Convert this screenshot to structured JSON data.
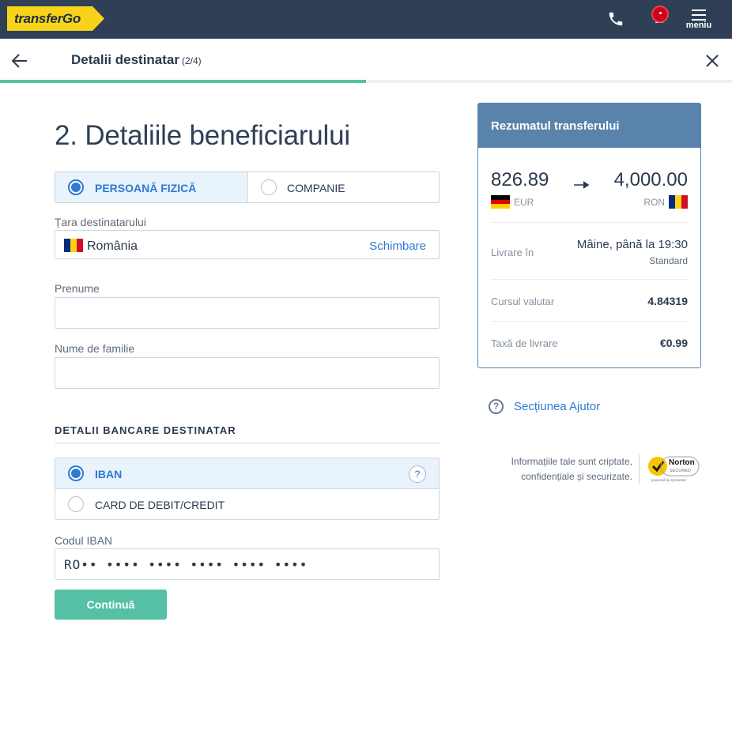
{
  "header": {
    "logo_text": "transferGo",
    "menu_label": "meniu",
    "brand_yellow": "#f7d31a",
    "bar_color": "#2f4056"
  },
  "step": {
    "title": "Detalii destinatar",
    "count": "(2/4)",
    "progress": 0.5
  },
  "form": {
    "page_title": "2. Detaliile beneficiarului",
    "type_options": [
      {
        "label": "PERSOANĂ FIZICĂ",
        "selected": true
      },
      {
        "label": "COMPANIE",
        "selected": false
      }
    ],
    "country_label": "Țara destinatarului",
    "country_value": "România",
    "country_change": "Schimbare",
    "first_name_label": "Prenume",
    "first_name_value": "",
    "last_name_label": "Nume de familie",
    "last_name_value": "",
    "bank_section_title": "DETALII BANCARE DESTINATAR",
    "bank_options": [
      {
        "label": "IBAN",
        "selected": true,
        "help": "?"
      },
      {
        "label": "CARD DE DEBIT/CREDIT",
        "selected": false
      }
    ],
    "iban_label": "Codul IBAN",
    "iban_placeholder": "RO•• •••• •••• •••• •••• ••••",
    "continue_label": "Continuă",
    "accent_color": "#55c0a3",
    "link_color": "#2e7ad1"
  },
  "summary": {
    "title": "Rezumatul transferului",
    "send_amount": "826.89",
    "send_currency": "EUR",
    "receive_amount": "4,000.00",
    "receive_currency": "RON",
    "delivery_label": "Livrare în",
    "delivery_value": "Mâine, până la 19:30",
    "delivery_type": "Standard",
    "rate_label": "Cursul valutar",
    "rate_value": "4.84319",
    "fee_label": "Taxă de livrare",
    "fee_value": "€0.99",
    "header_color": "#5a83ac"
  },
  "help": {
    "icon": "?",
    "label": "Secțiunea Ajutor"
  },
  "security": {
    "line1": "Informațiile tale sunt criptate,",
    "line2": "confidențiale și securizate.",
    "badge_name": "Norton",
    "badge_sub": "SECURED",
    "badge_powered": "powered by Symantec"
  }
}
